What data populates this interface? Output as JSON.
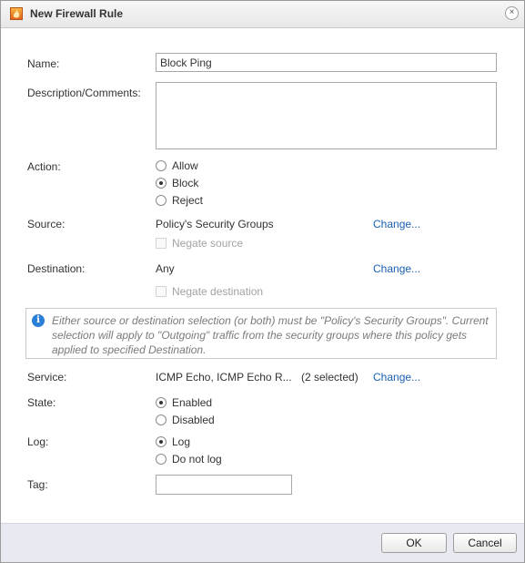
{
  "dialog": {
    "title": "New Firewall Rule",
    "title_icon": "firewall-flame-icon",
    "close_glyph": "×"
  },
  "form": {
    "name_label": "Name:",
    "name_value": "Block Ping",
    "description_label": "Description/Comments:",
    "description_value": "",
    "action": {
      "label": "Action:",
      "options": [
        "Allow",
        "Block",
        "Reject"
      ],
      "selected": "Block"
    },
    "source": {
      "label": "Source:",
      "value": "Policy's Security Groups",
      "change_link": "Change...",
      "negate_label": "Negate source",
      "negate_checked": false,
      "negate_enabled": false
    },
    "destination": {
      "label": "Destination:",
      "value": "Any",
      "change_link": "Change...",
      "negate_label": "Negate destination",
      "negate_checked": false,
      "negate_enabled": false
    },
    "info_message": "Either source or destination selection (or both) must be \"Policy's Security Groups\". Current selection will apply to \"Outgoing\" traffic from the security groups where this policy gets applied to specified Destination.",
    "service": {
      "label": "Service:",
      "value": "ICMP Echo, ICMP Echo R...",
      "count": "(2 selected)",
      "change_link": "Change..."
    },
    "state": {
      "label": "State:",
      "options": [
        "Enabled",
        "Disabled"
      ],
      "selected": "Enabled"
    },
    "log": {
      "label": "Log:",
      "options": [
        "Log",
        "Do not log"
      ],
      "selected": "Log"
    },
    "tag_label": "Tag:",
    "tag_value": ""
  },
  "footer": {
    "ok_label": "OK",
    "cancel_label": "Cancel"
  },
  "colors": {
    "link": "#1a5fb4",
    "info_icon": "#2b7fd6",
    "footer_bg": "#e9e9f2"
  }
}
